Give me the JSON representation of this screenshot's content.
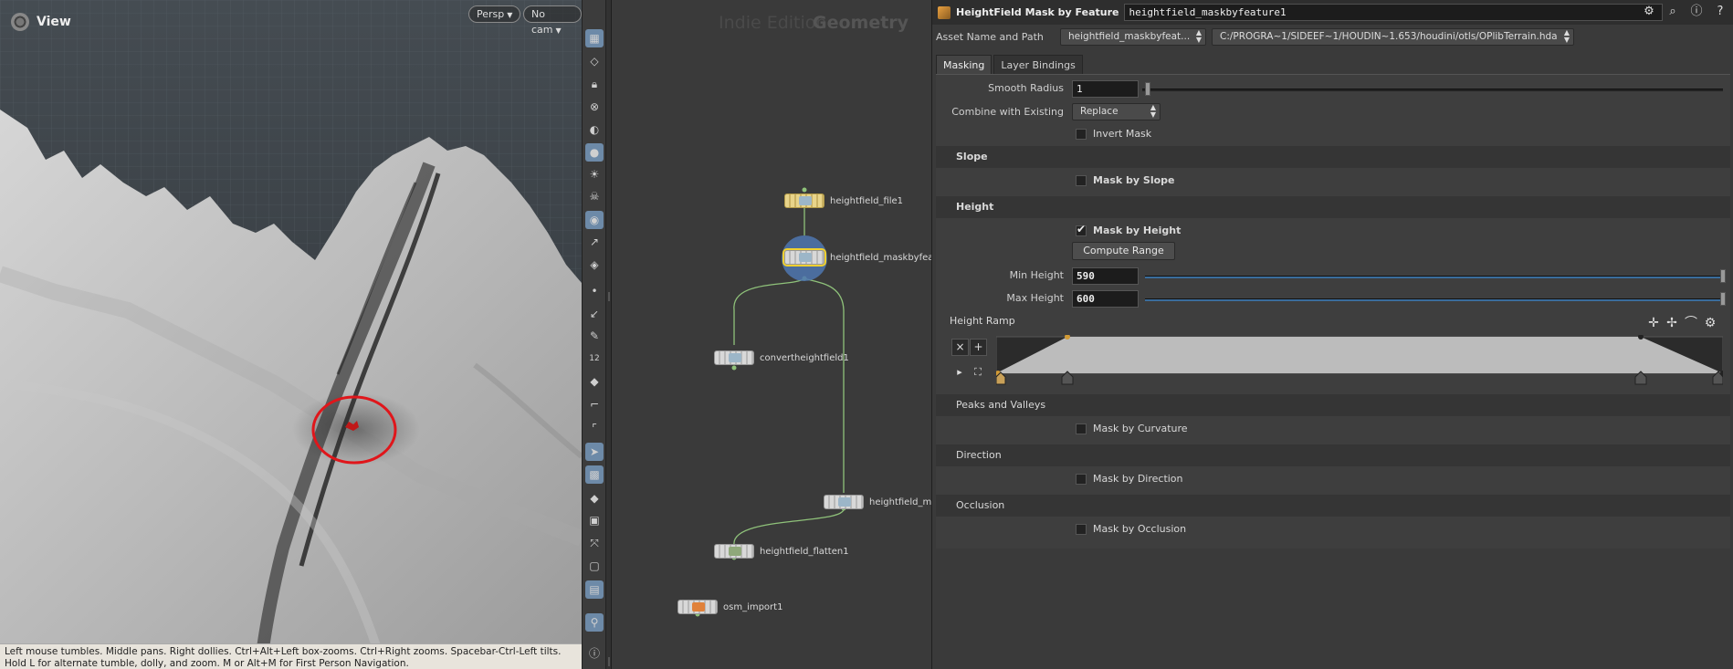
{
  "viewport": {
    "title": "View",
    "persp_label": "Persp",
    "cam_label": "No cam",
    "status": "Left mouse tumbles. Middle pans. Right dollies. Ctrl+Alt+Left box-zooms. Ctrl+Right zooms. Spacebar-Ctrl-Left tilts. Hold L for alternate tumble, dolly, and zoom. M or Alt+M for First Person Navigation.",
    "annotation_color": "#e0161b"
  },
  "toolbar": {
    "icons": [
      "display-options-icon",
      "ghost-icon",
      "lock-icon",
      "snap-icon",
      "shading-icon",
      "light-icon",
      "headlight-icon",
      "skull-icon",
      "camera-icon",
      "vector-icon",
      "hide-icon",
      "point-icon",
      "normal-icon",
      "pen-icon",
      "number-icon",
      "paint-icon",
      "brush-icon",
      "frame-icon",
      "select-icon",
      "grid-icon",
      "layer-icon",
      "texture-icon",
      "transform-icon",
      "visibility-icon",
      "render-icon",
      "pin-icon",
      "info-icon"
    ],
    "number_label": "12"
  },
  "network": {
    "watermark_left": "Indie Edition",
    "watermark_right": "Geometry",
    "nodes": [
      {
        "label": "heightfield_file1"
      },
      {
        "label": "heightfield_maskbyfeature"
      },
      {
        "label": "convertheightfield1"
      },
      {
        "label": "heightfield_mask"
      },
      {
        "label": "heightfield_flatten1"
      },
      {
        "label": "osm_import1"
      }
    ],
    "wire_color": "#8fc27a"
  },
  "params": {
    "type_label": "HeightField Mask by Feature",
    "node_name": "heightfield_maskbyfeature1",
    "asset_label": "Asset Name and Path",
    "asset_name": "heightfield_maskbyfeat...",
    "asset_path": "C:/PROGRA~1/SIDEEF~1/HOUDIN~1.653/houdini/otls/OPlibTerrain.hda",
    "tabs": [
      "Masking",
      "Layer Bindings"
    ],
    "smooth_radius_label": "Smooth Radius",
    "smooth_radius_value": "1",
    "combine_label": "Combine with Existing",
    "combine_value": "Replace",
    "invert_mask_label": "Invert Mask",
    "slope_section": "Slope",
    "mask_by_slope_label": "Mask by Slope",
    "height_section": "Height",
    "mask_by_height_label": "Mask by Height",
    "compute_range_label": "Compute Range",
    "min_height_label": "Min Height",
    "min_height_value": "590",
    "max_height_label": "Max Height",
    "max_height_value": "600",
    "height_ramp_label": "Height Ramp",
    "peaks_section": "Peaks and Valleys",
    "mask_by_curvature_label": "Mask by Curvature",
    "direction_section": "Direction",
    "mask_by_direction_label": "Mask by Direction",
    "occlusion_section": "Occlusion",
    "mask_by_occlusion_label": "Mask by Occlusion",
    "ramp_remove_label": "×",
    "ramp_add_label": "+",
    "ramp_play_label": "▸"
  }
}
